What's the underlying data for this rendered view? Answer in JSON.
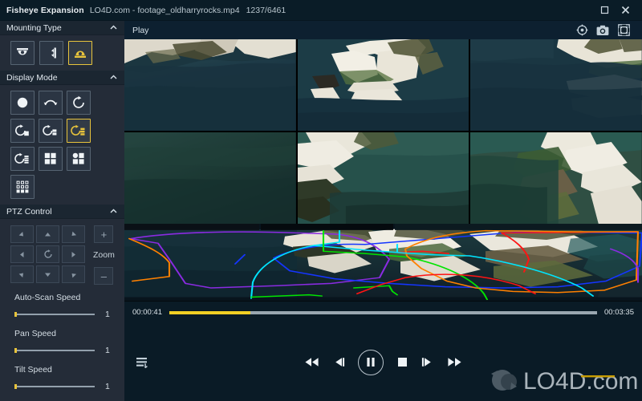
{
  "window": {
    "app_title": "Fisheye Expansion",
    "document": "LO4D.com - footage_oldharryrocks.mp4",
    "frames": "1237/6461",
    "maximize_icon": "maximize-icon",
    "close_icon": "close-icon"
  },
  "sidebar": {
    "panels": [
      {
        "title": "Mounting Type",
        "collapse_icon": "chevron-up-icon",
        "buttons": [
          {
            "name": "mount-ceiling",
            "icon": "ceiling-dome-icon",
            "selected": false
          },
          {
            "name": "mount-wall",
            "icon": "wall-dome-icon",
            "selected": false
          },
          {
            "name": "mount-ground",
            "icon": "ground-dome-icon",
            "selected": true
          }
        ]
      },
      {
        "title": "Display Mode",
        "collapse_icon": "chevron-up-icon",
        "buttons": [
          {
            "name": "mode-original-circle",
            "icon": "circle-icon",
            "selected": false
          },
          {
            "name": "mode-single-arc",
            "icon": "arc-arrow-icon",
            "selected": false
          },
          {
            "name": "mode-360-rotate",
            "icon": "circle-arrow-icon",
            "selected": false
          },
          {
            "name": "mode-arrow-one-panel",
            "icon": "arrow-one-panel-icon",
            "selected": false
          },
          {
            "name": "mode-arrow-two-panel",
            "icon": "arrow-two-panel-icon",
            "selected": false
          },
          {
            "name": "mode-arrow-three-panel",
            "icon": "arrow-three-panel-icon",
            "selected": true
          },
          {
            "name": "mode-arrow-four-panel",
            "icon": "arrow-four-panel-icon",
            "selected": false
          },
          {
            "name": "mode-quad",
            "icon": "quad-grid-icon",
            "selected": false
          },
          {
            "name": "mode-circle-quad",
            "icon": "circle-quad-icon",
            "selected": false
          },
          {
            "name": "mode-nine-grid",
            "icon": "nine-grid-icon",
            "selected": false
          }
        ]
      },
      {
        "title": "PTZ Control",
        "collapse_icon": "chevron-up-icon",
        "dpad": [
          {
            "name": "ptz-up-left",
            "icon": "arrow-up-left-icon"
          },
          {
            "name": "ptz-up",
            "icon": "arrow-up-icon"
          },
          {
            "name": "ptz-up-right",
            "icon": "arrow-up-right-icon"
          },
          {
            "name": "ptz-left",
            "icon": "arrow-left-icon"
          },
          {
            "name": "ptz-auto-rotate",
            "icon": "rotate-icon"
          },
          {
            "name": "ptz-right",
            "icon": "arrow-right-icon"
          },
          {
            "name": "ptz-down-left",
            "icon": "arrow-down-left-icon"
          },
          {
            "name": "ptz-down",
            "icon": "arrow-down-icon"
          },
          {
            "name": "ptz-down-right",
            "icon": "arrow-down-right-icon"
          }
        ],
        "zoom_in_label": "+",
        "zoom_label": "Zoom",
        "zoom_out_label": "–",
        "sliders": [
          {
            "label": "Auto-Scan Speed",
            "value": "1"
          },
          {
            "label": "Pan Speed",
            "value": "1"
          },
          {
            "label": "Tilt Speed",
            "value": "1"
          }
        ]
      }
    ]
  },
  "main": {
    "tab_label": "Play",
    "toolbar_icons": [
      {
        "name": "target-icon"
      },
      {
        "name": "snapshot-camera-icon"
      },
      {
        "name": "fullscreen-icon"
      }
    ],
    "grid_cells": [
      {
        "name": "view-cell-1"
      },
      {
        "name": "view-cell-2"
      },
      {
        "name": "view-cell-3"
      },
      {
        "name": "view-cell-4"
      },
      {
        "name": "view-cell-5"
      },
      {
        "name": "view-cell-6"
      }
    ],
    "roi_colors": [
      "#8a2be2",
      "#1535ff",
      "#00e5ff",
      "#00e400",
      "#ff8000",
      "#ff1414"
    ]
  },
  "player": {
    "current_time": "00:00:41",
    "total_time": "00:03:35",
    "progress_percent": 19,
    "progress_color": "#f2d024",
    "playlist_icon": "playlist-icon",
    "controls": [
      {
        "name": "rewind-button",
        "icon": "rewind-icon"
      },
      {
        "name": "step-back-button",
        "icon": "step-back-icon"
      },
      {
        "name": "pause-button",
        "icon": "pause-icon"
      },
      {
        "name": "stop-button",
        "icon": "stop-icon"
      },
      {
        "name": "step-forward-button",
        "icon": "step-forward-icon"
      },
      {
        "name": "fast-forward-button",
        "icon": "fast-forward-icon"
      }
    ],
    "watermark_text": "LO4D.com"
  }
}
